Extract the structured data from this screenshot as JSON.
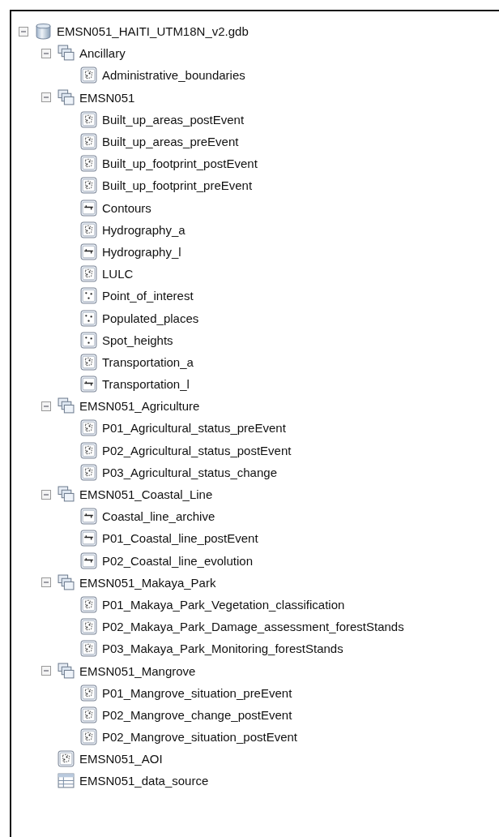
{
  "tree": [
    {
      "kind": "database",
      "label": "EMSN051_HAITI_UTM18N_v2.gdb",
      "expanded": true,
      "children": [
        {
          "kind": "dataset",
          "label": "Ancillary",
          "expanded": true,
          "children": [
            {
              "kind": "polygon",
              "label": "Administrative_boundaries"
            }
          ]
        },
        {
          "kind": "dataset",
          "label": "EMSN051",
          "expanded": true,
          "children": [
            {
              "kind": "polygon",
              "label": "Built_up_areas_postEvent"
            },
            {
              "kind": "polygon",
              "label": "Built_up_areas_preEvent"
            },
            {
              "kind": "polygon",
              "label": "Built_up_footprint_postEvent"
            },
            {
              "kind": "polygon",
              "label": "Built_up_footprint_preEvent"
            },
            {
              "kind": "line",
              "label": "Contours"
            },
            {
              "kind": "polygon",
              "label": "Hydrography_a"
            },
            {
              "kind": "line",
              "label": "Hydrography_l"
            },
            {
              "kind": "polygon",
              "label": "LULC"
            },
            {
              "kind": "point",
              "label": "Point_of_interest"
            },
            {
              "kind": "point",
              "label": "Populated_places"
            },
            {
              "kind": "point",
              "label": "Spot_heights"
            },
            {
              "kind": "polygon",
              "label": "Transportation_a"
            },
            {
              "kind": "line",
              "label": "Transportation_l"
            }
          ]
        },
        {
          "kind": "dataset",
          "label": "EMSN051_Agriculture",
          "expanded": true,
          "children": [
            {
              "kind": "polygon",
              "label": "P01_Agricultural_status_preEvent"
            },
            {
              "kind": "polygon",
              "label": "P02_Agricultural_status_postEvent"
            },
            {
              "kind": "polygon",
              "label": "P03_Agricultural_status_change"
            }
          ]
        },
        {
          "kind": "dataset",
          "label": "EMSN051_Coastal_Line",
          "expanded": true,
          "children": [
            {
              "kind": "line",
              "label": "Coastal_line_archive"
            },
            {
              "kind": "line",
              "label": "P01_Coastal_line_postEvent"
            },
            {
              "kind": "line",
              "label": "P02_Coastal_line_evolution"
            }
          ]
        },
        {
          "kind": "dataset",
          "label": "EMSN051_Makaya_Park",
          "expanded": true,
          "children": [
            {
              "kind": "polygon",
              "label": "P01_Makaya_Park_Vegetation_classification"
            },
            {
              "kind": "polygon",
              "label": "P02_Makaya_Park_Damage_assessment_forestStands"
            },
            {
              "kind": "polygon",
              "label": "P03_Makaya_Park_Monitoring_forestStands"
            }
          ]
        },
        {
          "kind": "dataset",
          "label": "EMSN051_Mangrove",
          "expanded": true,
          "children": [
            {
              "kind": "polygon",
              "label": "P01_Mangrove_situation_preEvent"
            },
            {
              "kind": "polygon",
              "label": "P02_Mangrove_change_postEvent"
            },
            {
              "kind": "polygon",
              "label": "P02_Mangrove_situation_postEvent"
            }
          ]
        },
        {
          "kind": "polygon",
          "label": "EMSN051_AOI"
        },
        {
          "kind": "table",
          "label": "EMSN051_data_source"
        }
      ]
    }
  ]
}
